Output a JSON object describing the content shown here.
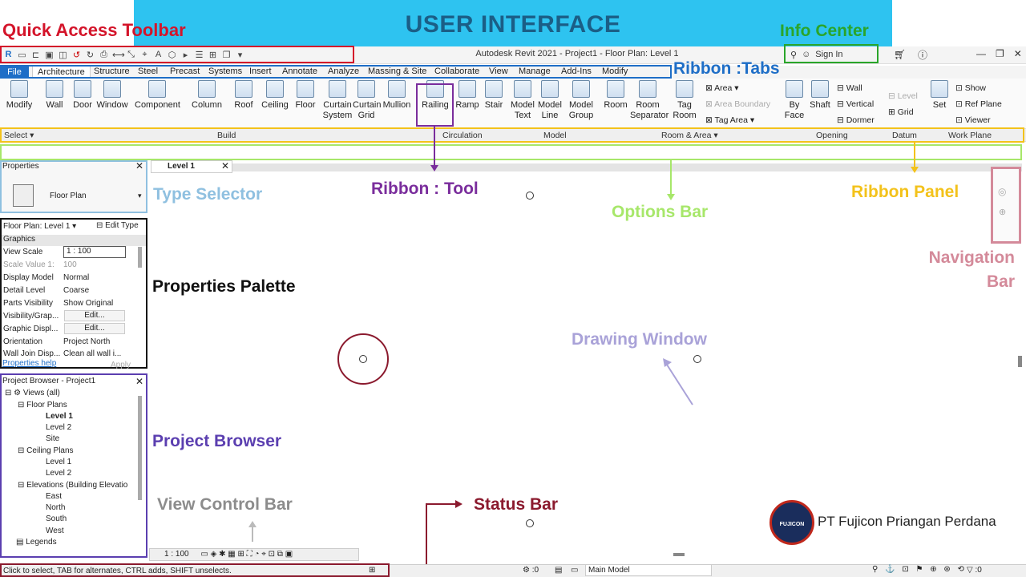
{
  "banner": {
    "title": "USER INTERFACE"
  },
  "window": {
    "title": "Autodesk Revit 2021 - Project1 - Floor Plan: Level 1",
    "sign_in": "Sign In",
    "controls": [
      "—",
      "❐",
      "✕"
    ]
  },
  "tabs": [
    "File",
    "Architecture",
    "Structure",
    "Steel",
    "Precast",
    "Systems",
    "Insert",
    "Annotate",
    "Analyze",
    "Massing & Site",
    "Collaborate",
    "View",
    "Manage",
    "Add-Ins",
    "Modify"
  ],
  "ribbon": {
    "tools": [
      {
        "label": "Modify"
      },
      {
        "label": "Wall"
      },
      {
        "label": "Door"
      },
      {
        "label": "Window"
      },
      {
        "label": "Component"
      },
      {
        "label": "Column"
      },
      {
        "label": "Roof"
      },
      {
        "label": "Ceiling"
      },
      {
        "label": "Floor"
      },
      {
        "label": "Curtain System"
      },
      {
        "label": "Curtain Grid"
      },
      {
        "label": "Mullion"
      },
      {
        "label": "Railing"
      },
      {
        "label": "Ramp"
      },
      {
        "label": "Stair"
      },
      {
        "label": "Model Text"
      },
      {
        "label": "Model Line"
      },
      {
        "label": "Model Group"
      },
      {
        "label": "Room"
      },
      {
        "label": "Room Separator"
      },
      {
        "label": "Tag Room"
      },
      {
        "label": "By Face"
      },
      {
        "label": "Shaft"
      },
      {
        "label": "Set"
      }
    ],
    "small_tools": {
      "area": "Area",
      "area_boundary": "Area Boundary",
      "tag_area": "Tag Area",
      "wall": "Wall",
      "vertical": "Vertical",
      "dormer": "Dormer",
      "level": "Level",
      "grid": "Grid",
      "show": "Show",
      "ref_plane": "Ref Plane",
      "viewer": "Viewer"
    },
    "panels": [
      "Select",
      "Build",
      "Circulation",
      "Model",
      "Room & Area",
      "Opening",
      "Datum",
      "Work Plane"
    ]
  },
  "properties": {
    "title": "Properties",
    "type": "Floor Plan",
    "instance": "Floor Plan: Level 1",
    "edit_type": "Edit Type",
    "group": "Graphics",
    "rows": [
      {
        "name": "View Scale",
        "value": "1 : 100"
      },
      {
        "name": "Scale Value   1:",
        "value": "100"
      },
      {
        "name": "Display Model",
        "value": "Normal"
      },
      {
        "name": "Detail Level",
        "value": "Coarse"
      },
      {
        "name": "Parts Visibility",
        "value": "Show Original"
      },
      {
        "name": "Visibility/Grap...",
        "value": "Edit..."
      },
      {
        "name": "Graphic Displ...",
        "value": "Edit..."
      },
      {
        "name": "Orientation",
        "value": "Project North"
      },
      {
        "name": "Wall Join Disp...",
        "value": "Clean all wall i..."
      }
    ],
    "help": "Properties help",
    "apply": "Apply"
  },
  "browser": {
    "title": "Project Browser - Project1",
    "items": [
      "Views (all)",
      "Floor Plans",
      "Level 1",
      "Level 2",
      "Site",
      "Ceiling Plans",
      "Level 1",
      "Level 2",
      "Elevations (Building Elevatio",
      "East",
      "North",
      "South",
      "West",
      "Legends"
    ]
  },
  "view_tab": "Level 1",
  "view_control": {
    "scale": "1 : 100"
  },
  "status": {
    "text": "Click to select, TAB for alternates, CTRL adds, SHIFT unselects.",
    "zero": ":0",
    "model": "Main Model",
    "filter": ":0"
  },
  "annotations": {
    "qat": "Quick Access Toolbar",
    "info_center": "Info Center",
    "ribbon_tabs": "Ribbon :Tabs",
    "type_selector": "Type Selector",
    "ribbon_tool": "Ribbon : Tool",
    "options_bar": "Options Bar",
    "ribbon_panel": "Ribbon Panel",
    "navigation_bar": "Navigation Bar",
    "properties_palette": "Properties Palette",
    "drawing_window": "Drawing Window",
    "project_browser": "Project Browser",
    "view_control_bar": "View Control Bar",
    "status_bar": "Status Bar"
  },
  "company": "PT Fujicon Priangan Perdana",
  "logo_text": "FUJICON",
  "colors": {
    "banner": "#2ec3f0",
    "banner_text": "#1b5e86",
    "qat": "#d4142a",
    "info": "#2aa52a",
    "tabs": "#1e6ec7",
    "type_selector": "#8fc0e0",
    "tool": "#7a2d9c",
    "options": "#a7e76a",
    "panel": "#f3c21b",
    "nav": "#d48a9a",
    "props": "#111111",
    "drawing": "#a9a2d8",
    "browser": "#5b3fb0",
    "viewctrl": "#8c8c8c",
    "status": "#8b1a2e"
  }
}
